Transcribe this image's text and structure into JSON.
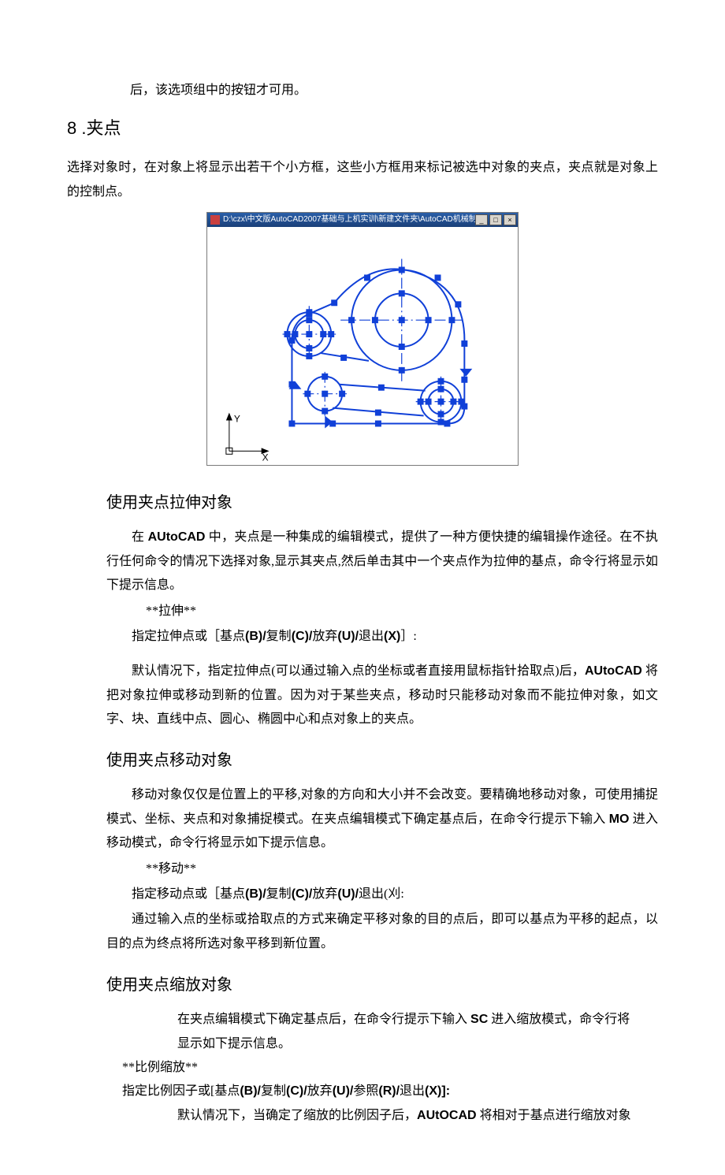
{
  "intro": "后，该选项组中的按钮才可用。",
  "section": {
    "num": "8",
    "title": ".夹点"
  },
  "p1": "选择对象时，在对象上将显示出若干个小方框，这些小方框用来标记被选中对象的夹点，夹点就是对象上的控制点。",
  "figure": {
    "titlebar": "D:\\czx\\中文版AutoCAD2007基础与上机实训\\新建文件夹\\AutoCAD机械制图图集范文",
    "axis_y": "Y",
    "axis_x": "X"
  },
  "s1": {
    "head": "使用夹点拉伸对象",
    "p1a": "在 ",
    "p1b": "AUtoCAD",
    "p1c": " 中，夹点是一种集成的编辑模式，提供了一种方便快捷的编辑操作途径。在不执行任何命令的情况下选择对象,显示其夹点,然后单击其中一个夹点作为拉伸的基点，命令行将显示如下提示信息。",
    "cmd1": "**拉伸**",
    "cmd2a": "指定拉伸点或［基点",
    "cmd2b": "(B)/",
    "cmd2c": "复制",
    "cmd2d": "(C)/",
    "cmd2e": "放弃",
    "cmd2f": "(U)/",
    "cmd2g": "退出",
    "cmd2h": "(X)",
    "cmd2i": "］:",
    "p2a": "默认情况下，指定拉伸点(可以通过输入点的坐标或者直接用鼠标指针拾取点)后，",
    "p2b": "AUtoCAD",
    "p2c": " 将把对象拉伸或移动到新的位置。因为对于某些夹点，移动时只能移动对象而不能拉伸对象，如文字、块、直线中点、圆心、椭圆中心和点对象上的夹点。"
  },
  "s2": {
    "head": "使用夹点移动对象",
    "p1a": "移动对象仅仅是位置上的平移,对象的方向和大小并不会改变。要精确地移动对象，可使用捕捉模式、坐标、夹点和对象捕捉模式。在夹点编辑模式下确定基点后，在命令行提示下输入 ",
    "p1b": "MO",
    "p1c": " 进入移动模式，命令行将显示如下提示信息。",
    "cmd1": "**移动**",
    "cmd2a": "指定移动点或［基点",
    "cmd2b": "(B)/",
    "cmd2c": "复制",
    "cmd2d": "(C)/",
    "cmd2e": "放弃",
    "cmd2f": "(U)/",
    "cmd2g": "退出(刈:",
    "p2": "通过输入点的坐标或拾取点的方式来确定平移对象的目的点后，即可以基点为平移的起点，以目的点为终点将所选对象平移到新位置。"
  },
  "s3": {
    "head": "使用夹点缩放对象",
    "p1a": "在夹点编辑模式下确定基点后，在命令行提示下输入 ",
    "p1b": "SC",
    "p1c": " 进入缩放模式，命令行将",
    "p1d": "显示如下提示信息。",
    "cmd1": "**比例缩放**",
    "cmd2a": "指定比例因子或[基点",
    "cmd2b": "(B)/",
    "cmd2c": "复制",
    "cmd2d": "(C)/",
    "cmd2e": "放弃",
    "cmd2f": "(U)/",
    "cmd2g": "参照",
    "cmd2h": "(R)/",
    "cmd2i": "退出",
    "cmd2j": "(X)]:",
    "p2a": "默认情况下，当确定了缩放的比例因子后，",
    "p2b": "AUtOCAD",
    "p2c": " 将相对于基点进行缩放对象"
  }
}
